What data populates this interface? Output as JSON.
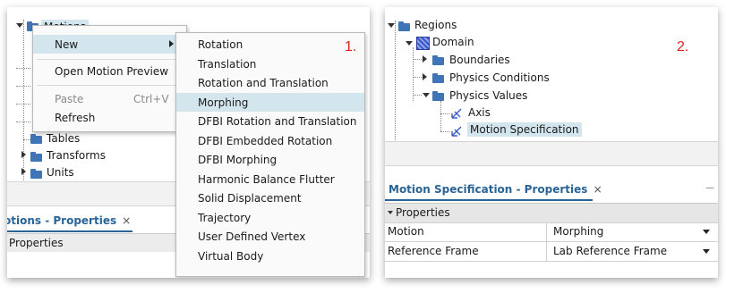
{
  "left": {
    "tree": {
      "motions_label": "Motions",
      "tables_label": "Tables",
      "transforms_label": "Transforms",
      "units_label": "Units"
    },
    "context_menu": {
      "new_label": "New",
      "open_motion_preview_label": "Open Motion Preview",
      "paste_label": "Paste",
      "paste_shortcut": "Ctrl+V",
      "refresh_label": "Refresh"
    },
    "submenu": {
      "items": [
        "Rotation",
        "Translation",
        "Rotation and Translation",
        "Morphing",
        "DFBI Rotation and Translation",
        "DFBI Embedded Rotation",
        "DFBI Morphing",
        "Harmonic Balance Flutter",
        "Solid Displacement",
        "Trajectory",
        "User Defined Vertex",
        "Virtual Body"
      ],
      "highlighted": "Morphing"
    },
    "step_label": "1.",
    "properties_tab": {
      "title": "otions - Properties",
      "close": "×",
      "header": "Properties"
    }
  },
  "right": {
    "tree": {
      "regions_label": "Regions",
      "domain_label": "Domain",
      "boundaries_label": "Boundaries",
      "physics_conditions_label": "Physics Conditions",
      "physics_values_label": "Physics Values",
      "axis_label": "Axis",
      "motion_specification_label": "Motion Specification"
    },
    "step_label": "2.",
    "properties_tab": {
      "title": "Motion Specification - Properties",
      "close": "×",
      "minimize": "—",
      "section_label": "Properties",
      "rows": [
        {
          "name": "Motion",
          "value": "Morphing"
        },
        {
          "name": "Reference Frame",
          "value": "Lab Reference Frame"
        }
      ]
    }
  },
  "colors": {
    "accent_blue": "#2a6496",
    "highlight": "#d3e6ee",
    "folder": "#3f74b6",
    "step_red": "#e02020"
  }
}
